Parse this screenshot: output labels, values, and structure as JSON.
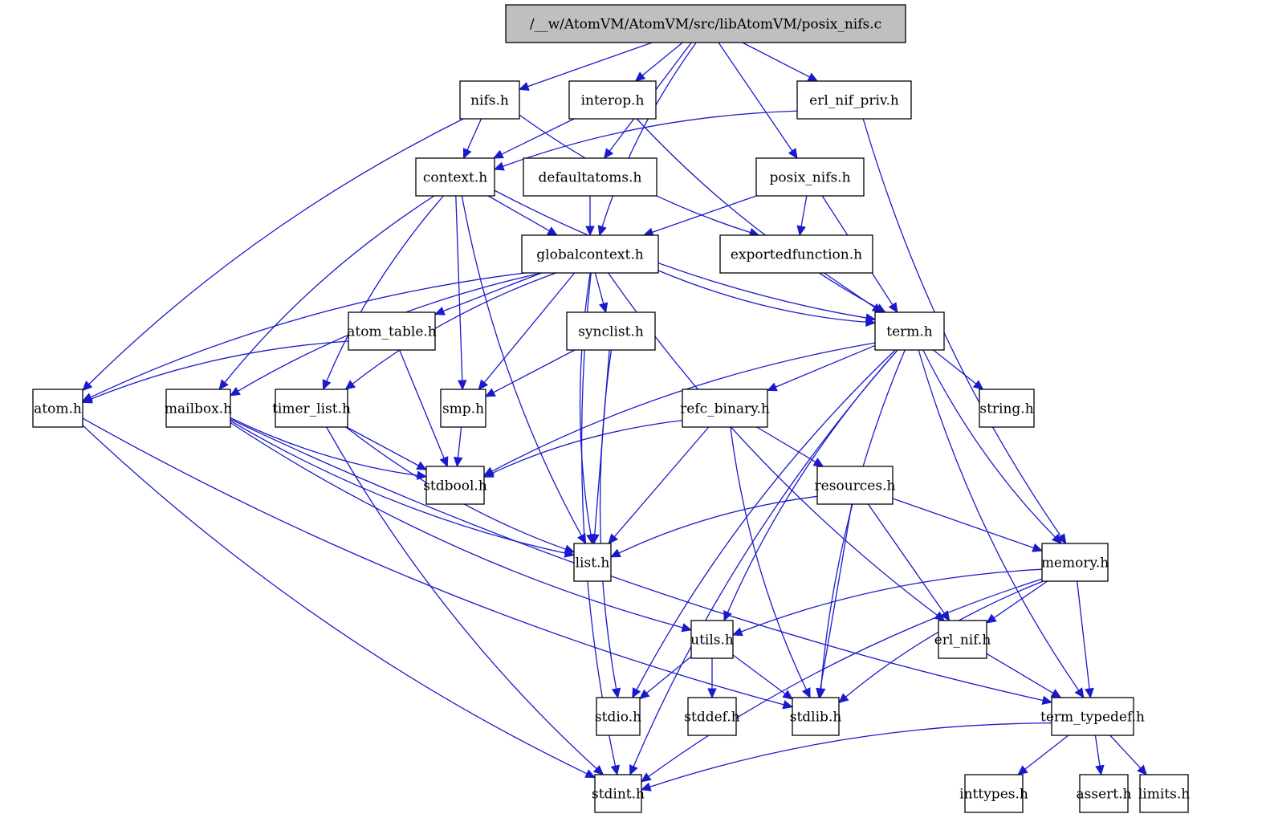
{
  "graph": {
    "title": "/__w/AtomVM/AtomVM/src/libAtomVM/posix_nifs.c",
    "colors": {
      "edge": "#1a1acc",
      "root_fill": "#bfbfbf",
      "node_fill": "#ffffff",
      "border": "#000000"
    },
    "nodes": [
      {
        "id": "root",
        "label": "/__w/AtomVM/AtomVM/src/libAtomVM/posix_nifs.c",
        "root": true
      },
      {
        "id": "nifs",
        "label": "nifs.h"
      },
      {
        "id": "interop",
        "label": "interop.h"
      },
      {
        "id": "erl_nif_priv",
        "label": "erl_nif_priv.h"
      },
      {
        "id": "context",
        "label": "context.h"
      },
      {
        "id": "defaultatoms",
        "label": "defaultatoms.h"
      },
      {
        "id": "posix_nifs_h",
        "label": "posix_nifs.h"
      },
      {
        "id": "globalcontext",
        "label": "globalcontext.h"
      },
      {
        "id": "exportedfunction",
        "label": "exportedfunction.h"
      },
      {
        "id": "atom_table",
        "label": "atom_table.h"
      },
      {
        "id": "synclist",
        "label": "synclist.h"
      },
      {
        "id": "term",
        "label": "term.h"
      },
      {
        "id": "atom",
        "label": "atom.h"
      },
      {
        "id": "mailbox",
        "label": "mailbox.h"
      },
      {
        "id": "timer_list",
        "label": "timer_list.h"
      },
      {
        "id": "smp",
        "label": "smp.h"
      },
      {
        "id": "refc_binary",
        "label": "refc_binary.h"
      },
      {
        "id": "string",
        "label": "string.h"
      },
      {
        "id": "stdbool",
        "label": "stdbool.h"
      },
      {
        "id": "resources",
        "label": "resources.h"
      },
      {
        "id": "list",
        "label": "list.h"
      },
      {
        "id": "memory",
        "label": "memory.h"
      },
      {
        "id": "utils",
        "label": "utils.h"
      },
      {
        "id": "erl_nif",
        "label": "erl_nif.h"
      },
      {
        "id": "stdio",
        "label": "stdio.h"
      },
      {
        "id": "stddef",
        "label": "stddef.h"
      },
      {
        "id": "stdlib",
        "label": "stdlib.h"
      },
      {
        "id": "term_typedef",
        "label": "term_typedef.h"
      },
      {
        "id": "stdint",
        "label": "stdint.h"
      },
      {
        "id": "inttypes",
        "label": "inttypes.h"
      },
      {
        "id": "assert",
        "label": "assert.h"
      },
      {
        "id": "limits",
        "label": "limits.h"
      }
    ],
    "edges": [
      [
        "root",
        "nifs"
      ],
      [
        "root",
        "interop"
      ],
      [
        "root",
        "defaultatoms"
      ],
      [
        "root",
        "globalcontext"
      ],
      [
        "root",
        "posix_nifs_h"
      ],
      [
        "root",
        "erl_nif_priv"
      ],
      [
        "nifs",
        "context"
      ],
      [
        "nifs",
        "atom"
      ],
      [
        "nifs",
        "exportedfunction"
      ],
      [
        "interop",
        "context"
      ],
      [
        "interop",
        "term"
      ],
      [
        "erl_nif_priv",
        "context"
      ],
      [
        "erl_nif_priv",
        "memory"
      ],
      [
        "context",
        "globalcontext"
      ],
      [
        "context",
        "term"
      ],
      [
        "context",
        "smp"
      ],
      [
        "context",
        "timer_list"
      ],
      [
        "context",
        "mailbox"
      ],
      [
        "context",
        "list"
      ],
      [
        "defaultatoms",
        "globalcontext"
      ],
      [
        "posix_nifs_h",
        "globalcontext"
      ],
      [
        "posix_nifs_h",
        "exportedfunction"
      ],
      [
        "posix_nifs_h",
        "term"
      ],
      [
        "exportedfunction",
        "term"
      ],
      [
        "globalcontext",
        "term"
      ],
      [
        "globalcontext",
        "atom_table"
      ],
      [
        "globalcontext",
        "synclist"
      ],
      [
        "globalcontext",
        "smp"
      ],
      [
        "globalcontext",
        "atom"
      ],
      [
        "globalcontext",
        "mailbox"
      ],
      [
        "globalcontext",
        "timer_list"
      ],
      [
        "globalcontext",
        "list"
      ],
      [
        "globalcontext",
        "erl_nif"
      ],
      [
        "globalcontext",
        "stdint"
      ],
      [
        "atom_table",
        "atom"
      ],
      [
        "atom_table",
        "stdbool"
      ],
      [
        "synclist",
        "smp"
      ],
      [
        "synclist",
        "list"
      ],
      [
        "synclist",
        "stdio"
      ],
      [
        "term",
        "refc_binary"
      ],
      [
        "term",
        "string"
      ],
      [
        "term",
        "memory"
      ],
      [
        "term",
        "utils"
      ],
      [
        "term",
        "stdbool"
      ],
      [
        "term",
        "stdio"
      ],
      [
        "term",
        "stdlib"
      ],
      [
        "term",
        "term_typedef"
      ],
      [
        "term",
        "stdint"
      ],
      [
        "atom",
        "stdint"
      ],
      [
        "atom",
        "stdlib"
      ],
      [
        "mailbox",
        "stdbool"
      ],
      [
        "mailbox",
        "list"
      ],
      [
        "mailbox",
        "utils"
      ],
      [
        "mailbox",
        "term_typedef"
      ],
      [
        "timer_list",
        "stdbool"
      ],
      [
        "timer_list",
        "list"
      ],
      [
        "timer_list",
        "stdint"
      ],
      [
        "smp",
        "stdbool"
      ],
      [
        "refc_binary",
        "stdbool"
      ],
      [
        "refc_binary",
        "list"
      ],
      [
        "refc_binary",
        "resources"
      ],
      [
        "refc_binary",
        "stdlib"
      ],
      [
        "resources",
        "list"
      ],
      [
        "resources",
        "memory"
      ],
      [
        "resources",
        "erl_nif"
      ],
      [
        "resources",
        "stdlib"
      ],
      [
        "memory",
        "utils"
      ],
      [
        "memory",
        "erl_nif"
      ],
      [
        "memory",
        "term_typedef"
      ],
      [
        "memory",
        "stdlib"
      ],
      [
        "memory",
        "stdint"
      ],
      [
        "utils",
        "stdio"
      ],
      [
        "utils",
        "stddef"
      ],
      [
        "utils",
        "stdlib"
      ],
      [
        "erl_nif",
        "term_typedef"
      ],
      [
        "term_typedef",
        "stdint"
      ],
      [
        "term_typedef",
        "inttypes"
      ],
      [
        "term_typedef",
        "assert"
      ],
      [
        "term_typedef",
        "limits"
      ]
    ]
  }
}
